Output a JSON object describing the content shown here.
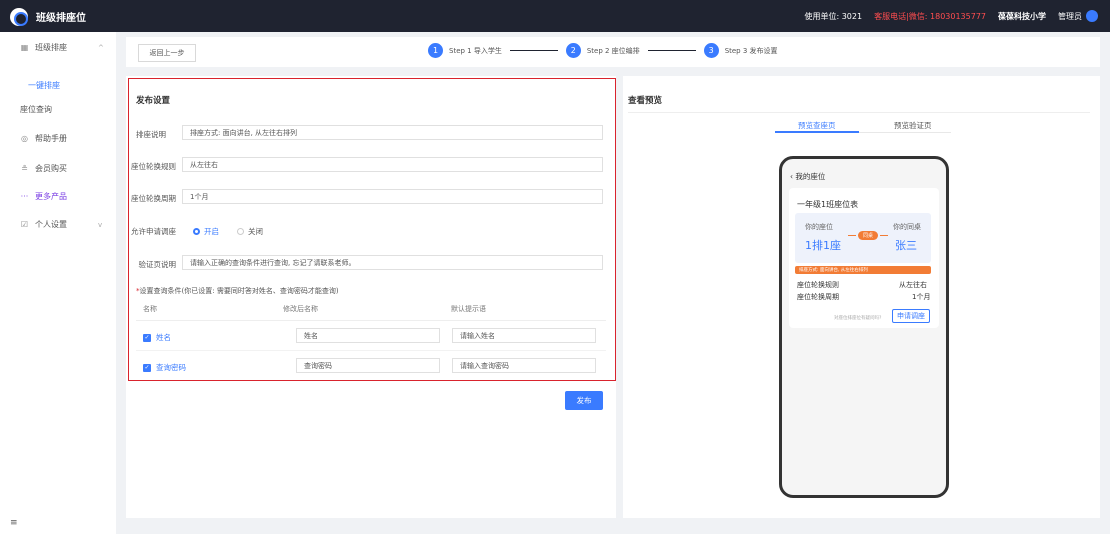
{
  "topbar": {
    "title": "班级排座位",
    "unit": "使用单位: 3021",
    "service": "客服电话|微信: 18030135777",
    "school": "葆葆科技小学",
    "admin": "管理员"
  },
  "sidebar": {
    "items": [
      {
        "label": "班级排座",
        "icon": "grid-icon"
      },
      {
        "label": "一键排座",
        "active": true
      },
      {
        "label": "座位查询"
      },
      {
        "label": "帮助手册",
        "icon": "help-icon"
      },
      {
        "label": "会员购买",
        "icon": "user-icon"
      },
      {
        "label": "更多产品",
        "icon": "more-icon"
      },
      {
        "label": "个人设置",
        "icon": "edit-icon"
      }
    ],
    "menu_toggle": "≡"
  },
  "steps": {
    "back_label": "返回上一步",
    "items": [
      {
        "num": "1",
        "label": "Step 1 导入学生"
      },
      {
        "num": "2",
        "label": "Step 2 座位编排"
      },
      {
        "num": "3",
        "label": "Step 3 发布设置"
      }
    ]
  },
  "publish": {
    "title": "发布设置",
    "fields": [
      {
        "label": "排座说明",
        "value": "排座方式: 面向讲台, 从左往右排列"
      },
      {
        "label": "座位轮换规则",
        "value": "从左往右"
      },
      {
        "label": "座位轮换周期",
        "value": "1个月"
      },
      {
        "label": "允许申请调座"
      },
      {
        "label": "验证页说明",
        "value": "请输入正确的查询条件进行查询, 忘记了请联系老师。"
      }
    ],
    "radio_on": "开启",
    "radio_off": "关闭",
    "query_title_req": "*",
    "query_title": "设置查询条件(你已设置: 需要同时答对姓名、查询密码才能查询)",
    "columns": [
      "名称",
      "修改后名称",
      "默认提示语"
    ],
    "rows": [
      {
        "name": "姓名",
        "rename": "姓名",
        "hint": "请输入姓名"
      },
      {
        "name": "查询密码",
        "rename": "查询密码",
        "hint": "请输入查询密码"
      }
    ],
    "publish_label": "发布"
  },
  "preview": {
    "title": "查看预览",
    "tabs": [
      "预览查座页",
      "预览验证页"
    ],
    "back": "我的座位",
    "class_title": "一年级1班座位表",
    "my_seat_label": "你的座位",
    "my_seat": "1排1座",
    "desk_label": "你的同桌",
    "desk": "张三",
    "pill": "同桌",
    "orange": "排座方式: 面向讲台, 从左往右排列",
    "rule_label": "座位轮换规则",
    "rule_value": "从左往右",
    "cycle_label": "座位轮换周期",
    "cycle_value": "1个月",
    "hint": "对座位排座位有疑问吗?",
    "apply": "申请调座"
  },
  "colors": {
    "accent": "#3a7bff",
    "topbar": "#1f2330",
    "highlight": "#d9232d",
    "orange": "#f27c35"
  }
}
